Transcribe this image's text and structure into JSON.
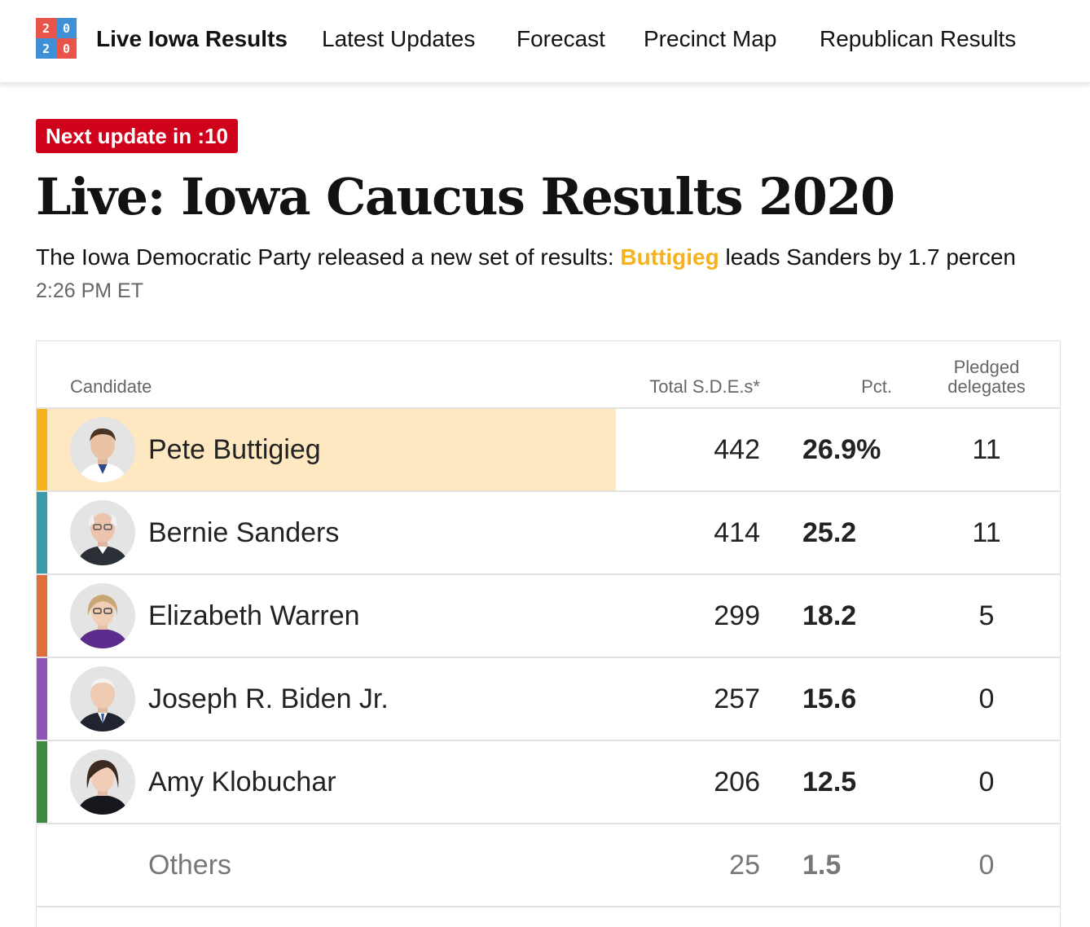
{
  "nav": {
    "logo": [
      "2",
      "0",
      "2",
      "0"
    ],
    "home": "Live Iowa Results",
    "links": [
      "Latest Updates",
      "Forecast",
      "Precinct Map",
      "Republican Results"
    ]
  },
  "header": {
    "badge": "Next update in :10",
    "title": "Live: Iowa Caucus Results 2020",
    "summary_before": "The Iowa Democratic Party released a new set of results: ",
    "summary_highlight": "Buttigieg",
    "summary_after": " leads Sanders by 1.7 percen",
    "timestamp": "2:26 PM ET"
  },
  "table": {
    "headers": {
      "candidate": "Candidate",
      "sde": "Total S.D.E.s*",
      "pct": "Pct.",
      "delegates": "Pledged delegates"
    },
    "rows": [
      {
        "name": "Pete Buttigieg",
        "sde": "442",
        "pct": "26.9%",
        "delegates": "11",
        "color": "#f5b21b",
        "leader": true
      },
      {
        "name": "Bernie Sanders",
        "sde": "414",
        "pct": "25.2",
        "delegates": "11",
        "color": "#3a9aab"
      },
      {
        "name": "Elizabeth Warren",
        "sde": "299",
        "pct": "18.2",
        "delegates": "5",
        "color": "#e0703b"
      },
      {
        "name": "Joseph R. Biden Jr.",
        "sde": "257",
        "pct": "15.6",
        "delegates": "0",
        "color": "#8f56b5"
      },
      {
        "name": "Amy Klobuchar",
        "sde": "206",
        "pct": "12.5",
        "delegates": "0",
        "color": "#3b8a3e"
      },
      {
        "name": "Others",
        "sde": "25",
        "pct": "1.5",
        "delegates": "0"
      }
    ]
  }
}
